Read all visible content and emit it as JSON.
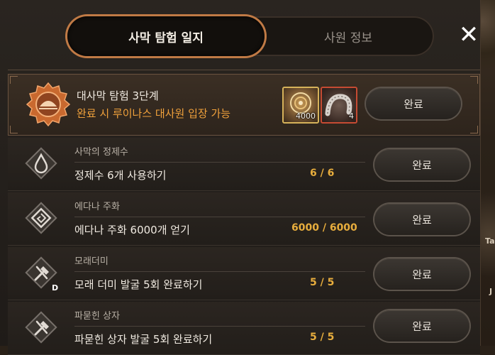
{
  "tabs": [
    {
      "label": "사막 탐험 일지",
      "active": true
    },
    {
      "label": "사원 정보",
      "active": false
    }
  ],
  "close_symbol": "✕",
  "main_quest": {
    "title": "대사막 탐험 3단계",
    "subtitle": "완료 시 루이나스 대사원 입장 가능",
    "emblem_icon": "desert-emblem-icon",
    "rewards": [
      {
        "icon": "gold-coin-icon",
        "count": "4000",
        "frame_color": "#d6b25a"
      },
      {
        "icon": "sand-worm-icon",
        "count": "4",
        "frame_color": "#c64b33"
      }
    ],
    "button_label": "완료"
  },
  "quests": [
    {
      "category": "사막의 정제수",
      "description": "정제수 6개 사용하기",
      "progress": "6 / 6",
      "icon": "water-drop-icon",
      "button_label": "완료"
    },
    {
      "category": "에다나 주화",
      "description": "에다나 주화 6000개 얻기",
      "progress": "6000 / 6000",
      "icon": "coin-spiral-icon",
      "button_label": "완료"
    },
    {
      "category": "모래더미",
      "description": "모래 더미 발굴 5회 완료하기",
      "progress": "5 / 5",
      "icon": "shovel-icon",
      "button_label": "완료"
    },
    {
      "category": "파묻힌 상자",
      "description": "파묻힌 상자 발굴 5회 완료하기",
      "progress": "5 / 5",
      "icon": "shovel-icon",
      "button_label": "완료"
    }
  ],
  "background_fragments": [
    "D",
    "Ta",
    "J"
  ],
  "colors": {
    "accent_orange": "#c07a45",
    "progress_gold": "#e7ad3d",
    "subtitle_orange": "#f0a13b"
  }
}
